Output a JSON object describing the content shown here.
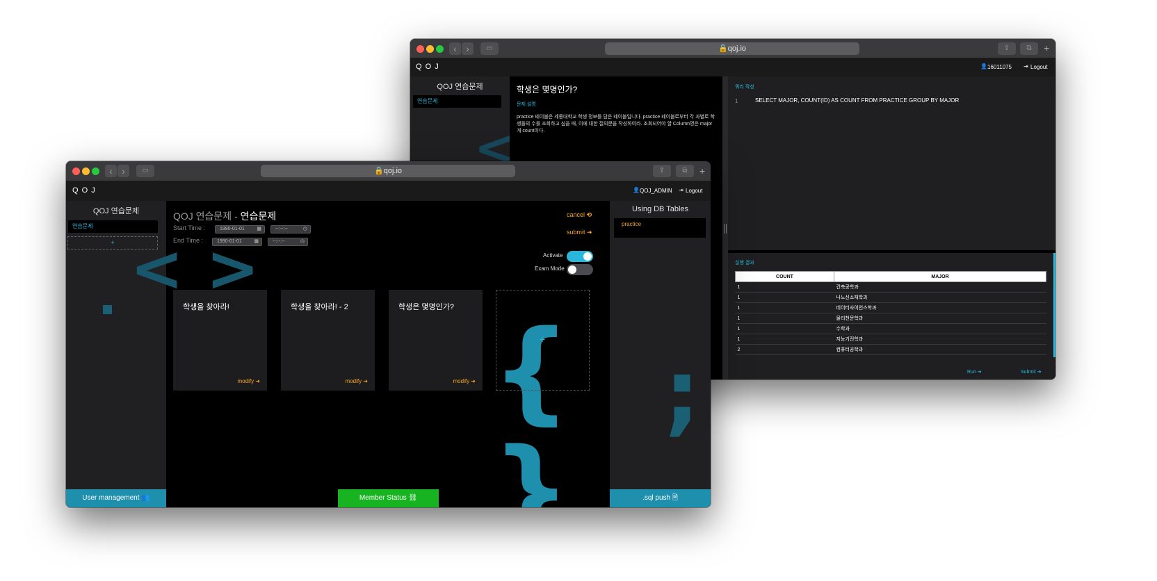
{
  "back_window": {
    "url": "qoj.io",
    "brand": "Q O J",
    "user": "16011075",
    "logout": "Logout",
    "sidebar": {
      "title": "QOJ 연습문제",
      "items": [
        "연습문제"
      ]
    },
    "problem": {
      "title": "학생은 몇명인가?",
      "desc_label": "문제 설명",
      "description": "practice 테이블은 세종대학교 학생 정보를 담은 테이블입니다. practice 테이블로부터 각 과별로 학생들의 수를 조회하고 싶을 때, 이에 대한 질의문을 작성하여라. 조회되어야 할 Column명은 major개 count이다."
    },
    "editor": {
      "label": "쿼리 작성",
      "line_no": "1",
      "query": "SELECT MAJOR, COUNT(ID) AS COUNT FROM PRACTICE GROUP BY MAJOR"
    },
    "result": {
      "label": "실행 결과",
      "columns": [
        "COUNT",
        "MAJOR"
      ],
      "rows": [
        [
          "1",
          "건축공학과"
        ],
        [
          "1",
          "나노신소재학과"
        ],
        [
          "1",
          "데이터사이언스학과"
        ],
        [
          "1",
          "물리천문학과"
        ],
        [
          "1",
          "수학과"
        ],
        [
          "1",
          "지능기전학과"
        ],
        [
          "2",
          "컴퓨터공학과"
        ]
      ]
    },
    "run_label": "Run",
    "submit_label": "Submit"
  },
  "front_window": {
    "url": "qoj.io",
    "brand": "Q O J",
    "user": "QOJ_ADMIN",
    "logout": "Logout",
    "sidebar": {
      "title": "QOJ 연습문제",
      "items": [
        "연습문제"
      ],
      "add": "+"
    },
    "heading": {
      "prefix": "QOJ 연습문제 - ",
      "name": "연습문제"
    },
    "start_label": "Start Time :",
    "end_label": "End Time :",
    "start_date": "1990-01-01",
    "end_date": "1990-01-01",
    "time_placeholder": "--:--:--",
    "cancel": "cancel",
    "submit": "submit",
    "activate_label": "Activate",
    "activate_on": true,
    "exam_label": "Exam Mode",
    "exam_on": false,
    "cards": [
      {
        "title": "학생을 찾아라!",
        "action": "modify"
      },
      {
        "title": "학생을 찾아라! - 2",
        "action": "modify"
      },
      {
        "title": "학생은 몇명인가?",
        "action": "modify"
      }
    ],
    "add_card": "+",
    "tables_panel": {
      "title": "Using DB Tables",
      "items": [
        "practice"
      ]
    },
    "footer": {
      "user_mgmt": "User management",
      "member_status": "Member Status",
      "sql_push": ".sql push"
    },
    "colors": {
      "accent": "#2ab7dc",
      "orange": "#f6a623",
      "green": "#17b321",
      "teal": "#1f8fae"
    }
  }
}
